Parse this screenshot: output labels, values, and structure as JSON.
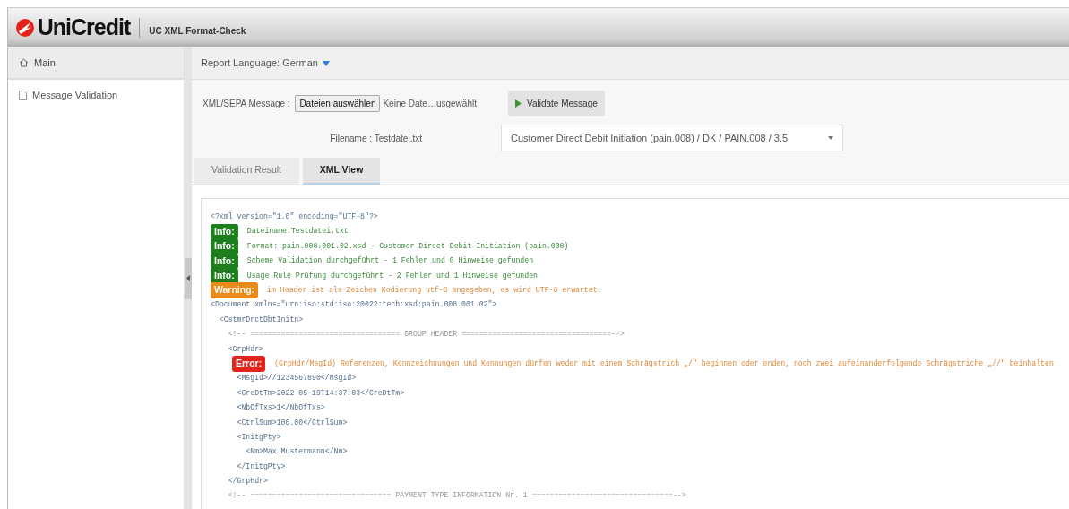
{
  "header": {
    "brand": "UniCredit",
    "app_title": "UC XML Format-Check"
  },
  "sidebar": {
    "title": "Main",
    "items": [
      {
        "label": "Message Validation"
      }
    ]
  },
  "report_language": {
    "label": "Report Language: German"
  },
  "form": {
    "message_label": "XML/SEPA Message :",
    "file_button": "Dateien auswählen",
    "file_status": "Keine Date…usgewählt",
    "validate_button": "Validate Message",
    "filename": "Filename : Testdatei.txt",
    "format_select": "Customer Direct Debit Initiation (pain.008) / DK / PAIN.008 / 3.5"
  },
  "tabs": [
    {
      "label": "Validation Result",
      "selected": false
    },
    {
      "label": "XML View",
      "selected": true
    }
  ],
  "xml_lines": [
    {
      "kind": "code",
      "text": "<?xml version=\"1.0\" encoding=\"UTF-8\"?>"
    },
    {
      "kind": "info",
      "badge": "Info:",
      "text": "Dateiname:Testdatei.txt"
    },
    {
      "kind": "info",
      "badge": "Info:",
      "text": "Format: pain.008.001.02.xsd - Customer Direct Debit Initiation (pain.008)"
    },
    {
      "kind": "info",
      "badge": "Info:",
      "text": "Scheme Validation durchgeführt - 1 Fehler und 0 Hinweise gefunden"
    },
    {
      "kind": "info",
      "badge": "Info:",
      "text": "Usage Rule Prüfung durchgeführt - 2 Fehler und 1 Hinweise gefunden"
    },
    {
      "kind": "warning",
      "badge": "Warning:",
      "text": "im Header ist als Zeichen Kodierung utf-8 angegeben, es wird UTF-8 erwartet."
    },
    {
      "kind": "code",
      "text": "<Document xmlns=\"urn:iso:std:iso:20022:tech:xsd:pain.008.001.02\">"
    },
    {
      "kind": "code",
      "text": "  <CstmrDrctDbtInitn>"
    },
    {
      "kind": "comment",
      "text": "    <!-- ================================== GROUP HEADER ==================================-->"
    },
    {
      "kind": "code",
      "text": "    <GrpHdr>"
    },
    {
      "kind": "error",
      "badge": "Error:",
      "text": "(GrpHdr/MsgId) Referenzen, Kennzeichnungen und Kennungen dürfen weder mit einem Schrägstrich „/\" beginnen oder enden, noch zwei aufeinanderfolgende Schrägstriche „//\" beinhalten"
    },
    {
      "kind": "code",
      "text": "      <MsgId>//1234567890</MsgId>"
    },
    {
      "kind": "code",
      "text": "      <CreDtTm>2022-05-19T14:37:03</CreDtTm>"
    },
    {
      "kind": "code",
      "text": "      <NbOfTxs>1</NbOfTxs>"
    },
    {
      "kind": "code",
      "text": "      <CtrlSum>100.00</CtrlSum>"
    },
    {
      "kind": "code",
      "text": "      <InitgPty>"
    },
    {
      "kind": "code",
      "text": "        <Nm>Max Mustermann</Nm>"
    },
    {
      "kind": "code",
      "text": "      </InitgPty>"
    },
    {
      "kind": "code",
      "text": "    </GrpHdr>"
    },
    {
      "kind": "comment",
      "text": "    <!-- ================================ PAYMENT TYPE INFORMATION Nr. 1 ================================-->"
    }
  ]
}
